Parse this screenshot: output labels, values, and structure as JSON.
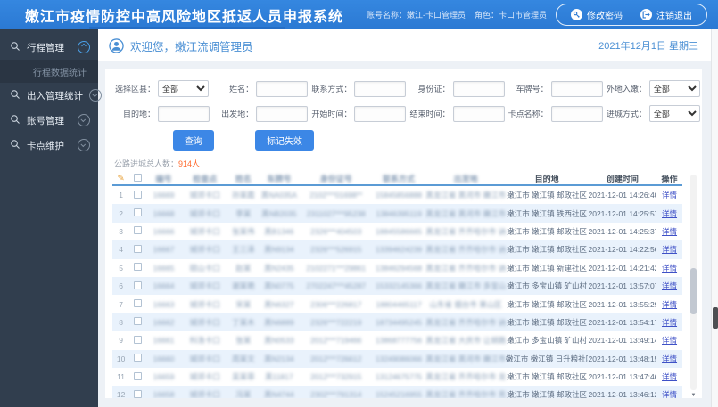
{
  "topbar": {
    "title": "嫩江市疫情防控中高风险地区抵返人员申报系统",
    "account": "账号名称：嫩江-卡口管理员",
    "role": "角色：卡口市管理员",
    "change_password": "修改密码",
    "logout": "注销退出"
  },
  "sidebar": {
    "items": [
      {
        "label": "行程管理",
        "state": "expanded"
      },
      {
        "label": "出入管理统计",
        "state": "collapsed"
      },
      {
        "label": "账号管理",
        "state": "collapsed"
      },
      {
        "label": "卡点维护",
        "state": "collapsed"
      }
    ],
    "active_submenu": "行程数据统计"
  },
  "welcome": {
    "greeting": "欢迎您，嫩江流调管理员",
    "date": "2021年12月1日 星期三"
  },
  "filters": [
    {
      "label": "选择区县：",
      "type": "select",
      "value": "全部"
    },
    {
      "label": "姓名：",
      "type": "input",
      "value": ""
    },
    {
      "label": "联系方式：",
      "type": "input",
      "value": ""
    },
    {
      "label": "身份证：",
      "type": "input",
      "value": ""
    },
    {
      "label": "车牌号：",
      "type": "input",
      "value": ""
    },
    {
      "label": "外地入嫩：",
      "type": "select",
      "value": "全部"
    },
    {
      "label": "目的地：",
      "type": "input",
      "value": ""
    },
    {
      "label": "出发地：",
      "type": "input",
      "value": ""
    },
    {
      "label": "开始时间：",
      "type": "input",
      "value": ""
    },
    {
      "label": "结束时间：",
      "type": "input",
      "value": ""
    },
    {
      "label": "卡点名称：",
      "type": "input",
      "value": ""
    },
    {
      "label": "进城方式：",
      "type": "select",
      "value": "全部"
    }
  ],
  "buttons": {
    "query": "查询",
    "mark_invalid": "标记失效"
  },
  "stats": {
    "label": "公路进城总人数：",
    "value": "914人"
  },
  "table": {
    "headers": [
      "编号",
      "检查点",
      "姓名",
      "车牌号",
      "身份证号",
      "联系方式",
      "出发地",
      "目的地",
      "创建时间",
      "操作"
    ],
    "blurred_columns": [
      "编号",
      "检查点",
      "姓名",
      "车牌号",
      "身份证号",
      "联系方式",
      "出发地"
    ],
    "action_label": "详情",
    "rows": [
      {
        "no": "1",
        "id": "16669",
        "checkpoint": "城郊卡口",
        "name": "孙某霞",
        "plate": "黑NA035A",
        "idcard": "2102***01698**",
        "phone": "15845856888",
        "origin": "黑龙江省 黑河市 嫩江市",
        "destination": "嫩江市 嫩江镇 邮政社区",
        "created": "2021-12-01 14:26:40"
      },
      {
        "no": "2",
        "id": "16668",
        "checkpoint": "城郊卡口",
        "name": "李某",
        "plate": "黑NB2035",
        "idcard": "2311027***95238",
        "phone": "13846395119",
        "origin": "黑龙江省 黑河市 嫩江市",
        "destination": "嫩江市 嫩江镇 铁西社区",
        "created": "2021-12-01 14:25:57"
      },
      {
        "no": "3",
        "id": "16666",
        "checkpoint": "城郊卡口",
        "name": "张某伟",
        "plate": "黑B1346",
        "idcard": "2326***404503",
        "phone": "18845586665",
        "origin": "黑龙江省 齐齐哈尔市 讷河市",
        "destination": "嫩江市 嫩江镇 邮政社区",
        "created": "2021-12-01 14:25:37"
      },
      {
        "no": "4",
        "id": "16667",
        "checkpoint": "城郊卡口",
        "name": "王三泽",
        "plate": "黑N9134",
        "idcard": "2326***526915",
        "phone": "13394624239",
        "origin": "黑龙江省 齐齐哈尔市 讷河市",
        "destination": "嫩江市 嫩江镇 邮政社区",
        "created": "2021-12-01 14:22:56"
      },
      {
        "no": "5",
        "id": "16665",
        "checkpoint": "砚山卡口",
        "name": "赵某",
        "plate": "黑N2435",
        "idcard": "2102271***29861",
        "phone": "13846294568",
        "origin": "黑龙江省 齐齐哈尔市 讷河市",
        "destination": "嫩江市 嫩江镇 新建社区",
        "created": "2021-12-01 14:21:42"
      },
      {
        "no": "6",
        "id": "16664",
        "checkpoint": "城郊卡口",
        "name": "谢某艳",
        "plate": "黑N0775",
        "idcard": "2702247***45287",
        "phone": "15332145366",
        "origin": "黑龙江省 嫩江市 多宝山镇",
        "destination": "嫩江市 多宝山镇 矿山村",
        "created": "2021-12-01 13:57:07"
      },
      {
        "no": "7",
        "id": "16663",
        "checkpoint": "城郊卡口",
        "name": "宋某",
        "plate": "黑N6327",
        "idcard": "2306***226817",
        "phone": "18804465117",
        "origin": "山东省 烟台市 莱山区",
        "destination": "嫩江市 嫩江镇 邮政社区",
        "created": "2021-12-01 13:55:29"
      },
      {
        "no": "8",
        "id": "16662",
        "checkpoint": "城郊卡口",
        "name": "丁某木",
        "plate": "黑N6889",
        "idcard": "2326***722219",
        "phone": "18734495245",
        "origin": "黑龙江省 齐齐哈尔市 讷河市",
        "destination": "嫩江市 嫩江镇 邮政社区",
        "created": "2021-12-01 13:54:17"
      },
      {
        "no": "9",
        "id": "16661",
        "checkpoint": "科洛卡口",
        "name": "张某",
        "plate": "黑N0533",
        "idcard": "2012***719466",
        "phone": "13868777756",
        "origin": "黑龙江省 大庆市 让胡路区",
        "destination": "嫩江市 多宝山镇 矿山村",
        "created": "2021-12-01 13:49:14"
      },
      {
        "no": "10",
        "id": "16660",
        "checkpoint": "城郊卡口",
        "name": "周某文",
        "plate": "黑N2134",
        "idcard": "2012***726612",
        "phone": "13249086066",
        "origin": "黑龙江省 黑河市 嫩江市",
        "destination": "嫩江市 嫩江镇 日升粮社区",
        "created": "2021-12-01 13:48:15"
      },
      {
        "no": "11",
        "id": "16659",
        "checkpoint": "城郊卡口",
        "name": "吴某菲",
        "plate": "黑11817",
        "idcard": "2012***732915",
        "phone": "13124675775",
        "origin": "黑龙江省 齐齐哈尔市 龙江县",
        "destination": "嫩江市 嫩江镇 邮政社区",
        "created": "2021-12-01 13:47:46"
      },
      {
        "no": "12",
        "id": "16658",
        "checkpoint": "城郊卡口",
        "name": "冯某",
        "plate": "黑N4744",
        "idcard": "2302***791314",
        "phone": "15245216955",
        "origin": "黑龙江省 齐齐哈尔市 克东县",
        "destination": "嫩江市 嫩江镇 邮政社区",
        "created": "2021-12-01 13:46:12"
      }
    ]
  }
}
